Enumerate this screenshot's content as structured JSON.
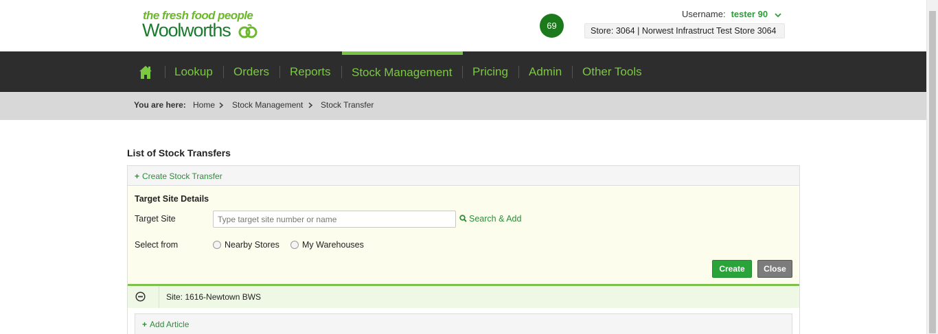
{
  "header": {
    "tagline": "the fresh food people",
    "brand": "Woolworths",
    "notification_count": "69",
    "username_label": "Username:",
    "username": "tester 90",
    "store": "Store: 3064 | Norwest Infrastruct Test Store 3064"
  },
  "nav": {
    "items": [
      "Lookup",
      "Orders",
      "Reports",
      "Stock Management",
      "Pricing",
      "Admin",
      "Other Tools"
    ],
    "active": "Stock Management"
  },
  "breadcrumb": {
    "prefix": "You are here:",
    "items": [
      "Home",
      "Stock Management",
      "Stock Transfer"
    ]
  },
  "main": {
    "title": "List of Stock Transfers",
    "create_link": "Create Stock Transfer",
    "target": {
      "heading": "Target Site Details",
      "site_label": "Target Site",
      "site_placeholder": "Type target site number or name",
      "search_add": "Search & Add",
      "select_label": "Select from",
      "options": [
        "Nearby Stores",
        "My Warehouses"
      ],
      "create_button": "Create",
      "close_button": "Close"
    },
    "site_row": "Site: 1616-Newtown BWS",
    "add_article": "Add Article"
  },
  "colors": {
    "brand_green": "#1a7a2e",
    "accent_green": "#7bc843",
    "nav_bg": "#2d2d2d",
    "create_button": "#2aa33a",
    "close_button": "#7c7c7c"
  },
  "icons": [
    "home-icon",
    "chevron-down-icon",
    "search-icon",
    "plus-icon",
    "minus-circle-icon",
    "chevron-right-icon"
  ]
}
